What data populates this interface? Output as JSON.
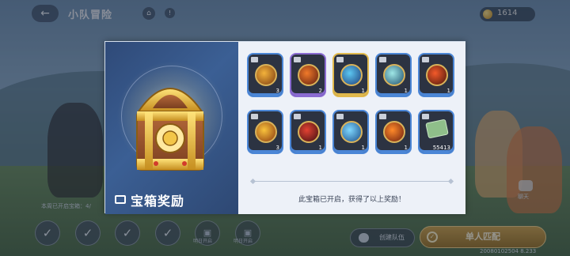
{
  "header": {
    "back_icon": "back-arrow-icon",
    "title": "小队冒险",
    "home_icon": "home-icon",
    "info_icon": "info-icon",
    "currency": {
      "icon": "coin-icon",
      "value": "1614"
    }
  },
  "modal": {
    "left_title": "宝箱奖励",
    "left_title_icon": "chest-ticket-icon",
    "message": "此宝箱已开启，获得了以上奖励！",
    "rewards": [
      {
        "icon": "fire-burst-item-icon",
        "rarity": "blue",
        "qty": "3",
        "colors": [
          "#f3b23b",
          "#7a3b12"
        ]
      },
      {
        "icon": "flame-orb-item-icon",
        "rarity": "purple",
        "qty": "2",
        "colors": [
          "#f07a2a",
          "#5e1d10"
        ]
      },
      {
        "icon": "water-slash-item-icon",
        "rarity": "gold",
        "qty": "1",
        "colors": [
          "#5cc7f2",
          "#1f3e7a"
        ]
      },
      {
        "icon": "wind-slash-item-icon",
        "rarity": "blue",
        "qty": "1",
        "colors": [
          "#9fe7e6",
          "#1f4f6e"
        ]
      },
      {
        "icon": "fire-tornado-item-icon",
        "rarity": "blue",
        "qty": "1",
        "colors": [
          "#f35a2a",
          "#4a160c"
        ]
      },
      {
        "icon": "explosion-item-icon",
        "rarity": "blue",
        "qty": "3",
        "colors": [
          "#f9c23c",
          "#8a3810"
        ]
      },
      {
        "icon": "red-eye-item-icon",
        "rarity": "blue",
        "qty": "1",
        "colors": [
          "#e34232",
          "#3c0f12"
        ]
      },
      {
        "icon": "ice-slash-item-icon",
        "rarity": "blue",
        "qty": "1",
        "colors": [
          "#7fd8ff",
          "#1b4d88"
        ]
      },
      {
        "icon": "fire-ball-item-icon",
        "rarity": "blue",
        "qty": "1",
        "colors": [
          "#ff8a2a",
          "#6a1d10"
        ]
      },
      {
        "icon": "money-bundle-icon",
        "rarity": "blue",
        "qty": "55413",
        "colors": [
          "#8fbf8a",
          "#3f5c3c"
        ]
      }
    ]
  },
  "background": {
    "weekly_text": "本周已开启宝箱：4/",
    "slots": [
      {
        "icon": "checkmark-icon",
        "state": "done",
        "label": ""
      },
      {
        "icon": "checkmark-icon",
        "state": "done",
        "label": ""
      },
      {
        "icon": "checkmark-icon",
        "state": "done",
        "label": ""
      },
      {
        "icon": "checkmark-icon",
        "state": "done",
        "label": ""
      },
      {
        "icon": "lock-icon",
        "state": "locked",
        "label": "明日开启"
      },
      {
        "icon": "lock-icon",
        "state": "locked",
        "label": "明日开启"
      }
    ],
    "side_label": "聊天",
    "team_button": {
      "icon": "team-icon",
      "label": "创建队伍"
    },
    "match_button": {
      "icon": "single-player-icon",
      "label": "单人匹配"
    },
    "build_id": "20080102504 8.233"
  },
  "colors": {
    "panel_right_bg": "#edf1f8",
    "panel_left_bg": "#3b5f94",
    "gold_accent": "#e0b84c",
    "purple_accent": "#8a6bd1",
    "blue_accent": "#4b86d6"
  }
}
